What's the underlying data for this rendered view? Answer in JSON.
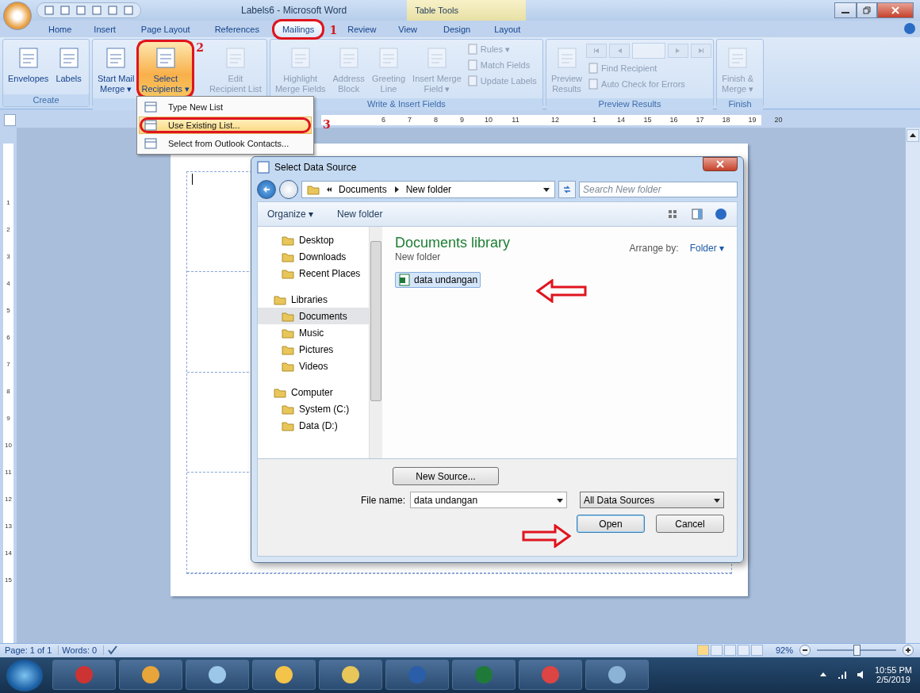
{
  "window": {
    "title": "Labels6 - Microsoft Word",
    "context_tab": "Table Tools"
  },
  "ribbon_tabs": [
    {
      "label": "Home",
      "selected": false
    },
    {
      "label": "Insert",
      "selected": false
    },
    {
      "label": "Page Layout",
      "selected": false
    },
    {
      "label": "References",
      "selected": false
    },
    {
      "label": "Mailings",
      "selected": true
    },
    {
      "label": "Review",
      "selected": false
    },
    {
      "label": "View",
      "selected": false
    },
    {
      "label": "Design",
      "selected": false
    },
    {
      "label": "Layout",
      "selected": false
    }
  ],
  "ribbon_groups": [
    {
      "label": "Create",
      "buttons": [
        {
          "lines": [
            "Envelopes"
          ],
          "pressed": false,
          "disabled": false
        },
        {
          "lines": [
            "Labels"
          ],
          "pressed": false,
          "disabled": false
        }
      ]
    },
    {
      "buttons": [
        {
          "lines": [
            "Start Mail",
            "Merge ▾"
          ],
          "pressed": false,
          "disabled": false
        },
        {
          "lines": [
            "Select",
            "Recipients ▾"
          ],
          "pressed": true,
          "disabled": false
        },
        {
          "lines": [
            "Edit",
            "Recipient List"
          ],
          "pressed": false,
          "disabled": true
        }
      ]
    },
    {
      "label": "Write & Insert Fields",
      "buttons": [
        {
          "lines": [
            "Highlight",
            "Merge Fields"
          ],
          "pressed": false,
          "disabled": true
        },
        {
          "lines": [
            "Address",
            "Block"
          ],
          "pressed": false,
          "disabled": true
        },
        {
          "lines": [
            "Greeting",
            "Line"
          ],
          "pressed": false,
          "disabled": true
        },
        {
          "lines": [
            "Insert Merge",
            "Field ▾"
          ],
          "pressed": false,
          "disabled": true
        }
      ],
      "small_buttons": [
        {
          "label": "Rules ▾",
          "disabled": true
        },
        {
          "label": "Match Fields",
          "disabled": true
        },
        {
          "label": "Update Labels",
          "disabled": true
        }
      ]
    },
    {
      "label": "Preview Results",
      "buttons": [
        {
          "lines": [
            "Preview",
            "Results"
          ],
          "pressed": false,
          "disabled": true
        }
      ],
      "record_nav": {
        "disabled": true
      },
      "small_buttons": [
        {
          "label": "Find Recipient",
          "disabled": true
        },
        {
          "label": "Auto Check for Errors",
          "disabled": true
        }
      ]
    },
    {
      "label": "Finish",
      "buttons": [
        {
          "lines": [
            "Finish &",
            "Merge ▾"
          ],
          "pressed": false,
          "disabled": true
        }
      ]
    }
  ],
  "recipients_menu": [
    {
      "label": "Type New List",
      "selected": false
    },
    {
      "label": "Use Existing List...",
      "selected": true
    },
    {
      "label": "Select from Outlook Contacts...",
      "selected": false
    }
  ],
  "ruler_numbers": [
    "6",
    "7",
    "8",
    "9",
    "10",
    "11",
    "12",
    "1",
    "14",
    "15",
    "16",
    "17",
    "18",
    "19",
    "20"
  ],
  "vertical_ruler_numbers": [
    "1",
    "2",
    "3",
    "4",
    "5",
    "6",
    "7",
    "8",
    "9",
    "10",
    "11",
    "12",
    "13",
    "14",
    "15"
  ],
  "dialog": {
    "title": "Select Data Source",
    "breadcrumb": [
      "Documents",
      "New folder"
    ],
    "search": {
      "placeholder": "Search New folder"
    },
    "toolbar": [
      "Organize ▾",
      "New folder"
    ],
    "nav": [
      {
        "children": [
          {
            "label": "Desktop",
            "selected": false
          },
          {
            "label": "Downloads",
            "selected": false
          },
          {
            "label": "Recent Places",
            "selected": false
          }
        ]
      },
      {
        "label": "Libraries",
        "children": [
          {
            "label": "Documents",
            "selected": true
          },
          {
            "label": "Music",
            "selected": false
          },
          {
            "label": "Pictures",
            "selected": false
          },
          {
            "label": "Videos",
            "selected": false
          }
        ]
      },
      {
        "label": "Computer",
        "children": [
          {
            "label": "System (C:)",
            "selected": false
          },
          {
            "label": "Data (D:)",
            "selected": false
          }
        ]
      }
    ],
    "heading": "Documents library",
    "subheading": "New folder",
    "arrange_label": "Arrange by:",
    "arrange_value": "Folder ▾",
    "files": [
      {
        "name": "data undangan",
        "selected": true
      }
    ],
    "new_source": "New Source...",
    "file_name_label": "File name:",
    "file_name": "data undangan",
    "filter": "All Data Sources",
    "buttons": [
      {
        "label": "Open",
        "default": true
      },
      {
        "label": "Cancel",
        "default": false
      }
    ]
  },
  "annotations": [
    {
      "label": "1",
      "kind": "tab"
    },
    {
      "label": "2",
      "kind": "button"
    },
    {
      "label": "3",
      "kind": "menu"
    }
  ],
  "status_bar": {
    "page": "Page: 1 of 1",
    "words": "Words: 0",
    "zoom": "92%",
    "zoom_level": {
      "level": 0.5
    }
  },
  "taskbar": {
    "time": "10:55 PM",
    "date": "2/5/2019"
  }
}
